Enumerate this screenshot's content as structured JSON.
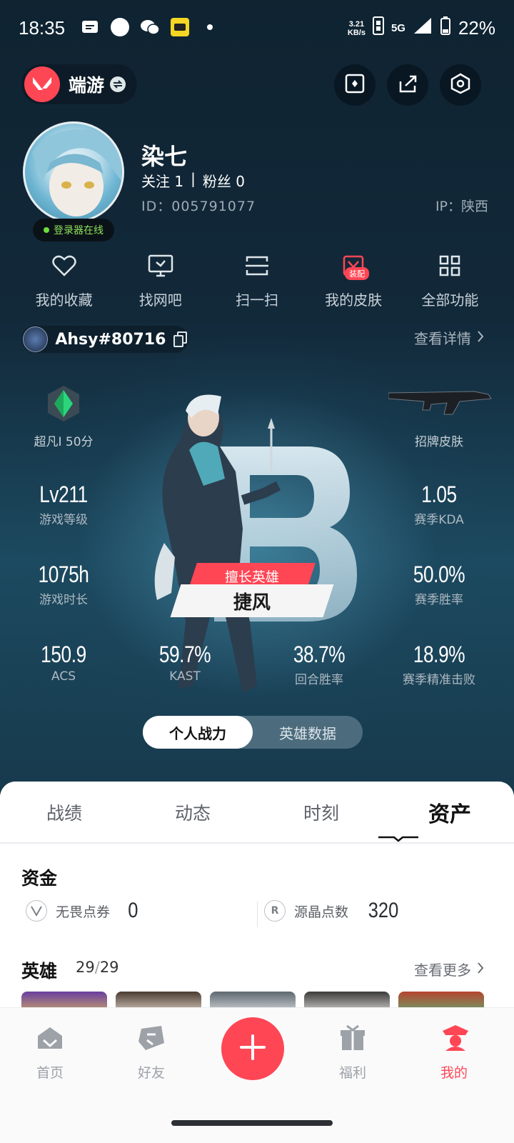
{
  "status_bar": {
    "time": "18:35",
    "net_speed_value": "3.21",
    "net_speed_unit": "KB/s",
    "network": "5G",
    "battery": "22%"
  },
  "header": {
    "game_name": "端游"
  },
  "profile": {
    "username": "染七",
    "follow_label": "关注 1",
    "divider": "|",
    "fans_label": "粉丝 0",
    "id_text": "ID：005791077",
    "ip_text": "IP：陕西",
    "online_status": "登录器在线"
  },
  "quick_menu": [
    {
      "label": "我的收藏",
      "icon": "heart-icon"
    },
    {
      "label": "找网吧",
      "icon": "monitor-icon"
    },
    {
      "label": "扫一扫",
      "icon": "scan-icon"
    },
    {
      "label": "我的皮肤",
      "icon": "skin-icon",
      "badge": "装配"
    },
    {
      "label": "全部功能",
      "icon": "grid-icon"
    }
  ],
  "account": {
    "riot_id": "Ahsy#80716",
    "detail_link": "查看详情"
  },
  "stats": {
    "rank_label": "超凡Ⅰ 50分",
    "skin_label": "招牌皮肤",
    "level_value": "Lv211",
    "level_label": "游戏等级",
    "kda_value": "1.05",
    "kda_label": "赛季KDA",
    "playtime_value": "1075h",
    "playtime_label": "游戏时长",
    "winrate_value": "50.0%",
    "winrate_label": "赛季胜率",
    "acs_value": "150.9",
    "acs_label": "ACS",
    "kast_value": "59.7%",
    "kast_label": "KAST",
    "round_win_value": "38.7%",
    "round_win_label": "回合胜率",
    "headshot_value": "18.9%",
    "headshot_label": "赛季精准击败",
    "fav_hero_tag": "擅长英雄",
    "fav_hero_name": "捷风"
  },
  "toggle": {
    "options": [
      "个人战力",
      "英雄数据"
    ],
    "active": 0
  },
  "tabs": [
    "战绩",
    "动态",
    "时刻",
    "资产"
  ],
  "active_tab": 3,
  "assets": {
    "funds_title": "资金",
    "vp_label": "无畏点券",
    "vp_value": "0",
    "rp_label": "源晶点数",
    "rp_value": "320",
    "heroes_title": "英雄",
    "heroes_owned": "29",
    "heroes_sep": "/",
    "heroes_total": "29",
    "more_link": "查看更多"
  },
  "bottom_nav": [
    {
      "label": "首页",
      "icon": "home-icon"
    },
    {
      "label": "好友",
      "icon": "friends-icon"
    },
    {
      "label": "福利",
      "icon": "gift-icon"
    },
    {
      "label": "我的",
      "icon": "profile-icon",
      "active": true
    }
  ],
  "colors": {
    "accent": "#ff4655",
    "online": "#6fdc3b"
  }
}
